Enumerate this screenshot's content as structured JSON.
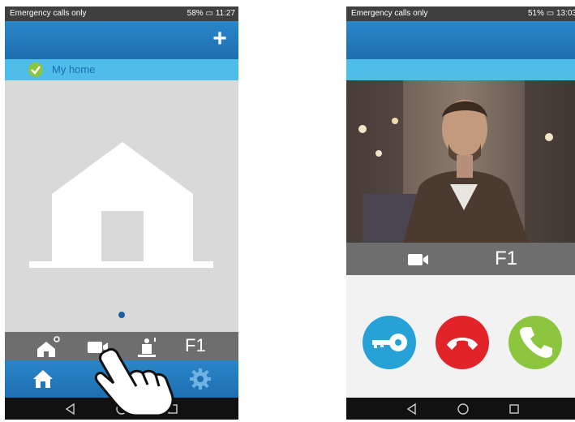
{
  "left_phone": {
    "status": {
      "carrier": "Emergency calls only",
      "indicators": "58%",
      "time": "11:27"
    },
    "appbar": {
      "add_icon": "plus-icon"
    },
    "home": {
      "label": "My home",
      "check_icon": "check-icon"
    },
    "toolbar": {
      "f1_label": "F1",
      "icons": [
        "home-settings-icon",
        "video-camera-icon",
        "doorbell-icon"
      ]
    },
    "bottom_nav": {
      "icons": [
        "home-icon",
        "gear-icon"
      ]
    },
    "gesture": "hand-pointer-icon"
  },
  "right_phone": {
    "status": {
      "carrier": "Emergency calls only",
      "indicators": "51%",
      "time": "13:03"
    },
    "video_bar": {
      "f1_label": "F1",
      "icon": "video-camera-icon"
    },
    "call_buttons": [
      "key-icon",
      "hang-up-icon",
      "answer-icon"
    ],
    "colors": {
      "key": "#27a2d9",
      "hangup": "#e2232a",
      "answer": "#8cc63f"
    }
  },
  "system_nav": {
    "icons": [
      "back-icon",
      "home-circle-icon",
      "recent-apps-icon"
    ]
  }
}
